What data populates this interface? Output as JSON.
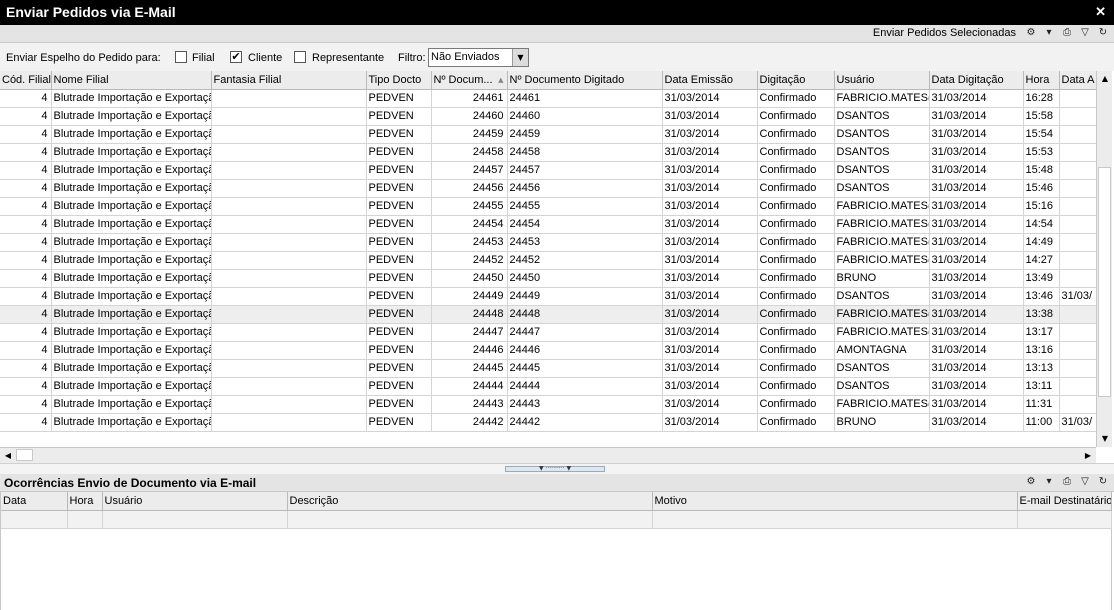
{
  "window": {
    "title": "Enviar Pedidos via E-Mail",
    "close": "✕"
  },
  "toolbar": {
    "send_selected_label": "Enviar Pedidos Selecionadas"
  },
  "filters": {
    "send_to_label": "Enviar Espelho do Pedido para:",
    "filial_label": "Filial",
    "filial_checked": false,
    "cliente_label": "Cliente",
    "cliente_checked": true,
    "representante_label": "Representante",
    "representante_checked": false,
    "filtro_label": "Filtro:",
    "filtro_value": "Não Enviados"
  },
  "orders_grid": {
    "columns": [
      "Cód. Filial",
      "Nome Filial",
      "Fantasia Filial",
      "Tipo Docto",
      "Nº Docum...",
      "Nº Documento Digitado",
      "Data Emissão",
      "Digitação",
      "Usuário",
      "Data Digitação",
      "Hora",
      "Data A"
    ],
    "sort_indicator": "▲",
    "selected_row": 12,
    "rows": [
      [
        "4",
        "Blutrade Importação e Exportação",
        "",
        "PEDVEN",
        "24461",
        "24461",
        "31/03/2014",
        "Confirmado",
        "FABRICIO.MATES(",
        "31/03/2014",
        "16:28",
        ""
      ],
      [
        "4",
        "Blutrade Importação e Exportação",
        "",
        "PEDVEN",
        "24460",
        "24460",
        "31/03/2014",
        "Confirmado",
        "DSANTOS",
        "31/03/2014",
        "15:58",
        ""
      ],
      [
        "4",
        "Blutrade Importação e Exportação",
        "",
        "PEDVEN",
        "24459",
        "24459",
        "31/03/2014",
        "Confirmado",
        "DSANTOS",
        "31/03/2014",
        "15:54",
        ""
      ],
      [
        "4",
        "Blutrade Importação e Exportação",
        "",
        "PEDVEN",
        "24458",
        "24458",
        "31/03/2014",
        "Confirmado",
        "DSANTOS",
        "31/03/2014",
        "15:53",
        ""
      ],
      [
        "4",
        "Blutrade Importação e Exportação",
        "",
        "PEDVEN",
        "24457",
        "24457",
        "31/03/2014",
        "Confirmado",
        "DSANTOS",
        "31/03/2014",
        "15:48",
        ""
      ],
      [
        "4",
        "Blutrade Importação e Exportação",
        "",
        "PEDVEN",
        "24456",
        "24456",
        "31/03/2014",
        "Confirmado",
        "DSANTOS",
        "31/03/2014",
        "15:46",
        ""
      ],
      [
        "4",
        "Blutrade Importação e Exportação",
        "",
        "PEDVEN",
        "24455",
        "24455",
        "31/03/2014",
        "Confirmado",
        "FABRICIO.MATES(",
        "31/03/2014",
        "15:16",
        ""
      ],
      [
        "4",
        "Blutrade Importação e Exportação",
        "",
        "PEDVEN",
        "24454",
        "24454",
        "31/03/2014",
        "Confirmado",
        "FABRICIO.MATES(",
        "31/03/2014",
        "14:54",
        ""
      ],
      [
        "4",
        "Blutrade Importação e Exportação",
        "",
        "PEDVEN",
        "24453",
        "24453",
        "31/03/2014",
        "Confirmado",
        "FABRICIO.MATES(",
        "31/03/2014",
        "14:49",
        ""
      ],
      [
        "4",
        "Blutrade Importação e Exportação",
        "",
        "PEDVEN",
        "24452",
        "24452",
        "31/03/2014",
        "Confirmado",
        "FABRICIO.MATES(",
        "31/03/2014",
        "14:27",
        ""
      ],
      [
        "4",
        "Blutrade Importação e Exportação",
        "",
        "PEDVEN",
        "24450",
        "24450",
        "31/03/2014",
        "Confirmado",
        "BRUNO",
        "31/03/2014",
        "13:49",
        ""
      ],
      [
        "4",
        "Blutrade Importação e Exportação",
        "",
        "PEDVEN",
        "24449",
        "24449",
        "31/03/2014",
        "Confirmado",
        "DSANTOS",
        "31/03/2014",
        "13:46",
        "31/03/"
      ],
      [
        "4",
        "Blutrade Importação e Exportação",
        "",
        "PEDVEN",
        "24448",
        "24448",
        "31/03/2014",
        "Confirmado",
        "FABRICIO.MATES(",
        "31/03/2014",
        "13:38",
        ""
      ],
      [
        "4",
        "Blutrade Importação e Exportação",
        "",
        "PEDVEN",
        "24447",
        "24447",
        "31/03/2014",
        "Confirmado",
        "FABRICIO.MATES(",
        "31/03/2014",
        "13:17",
        ""
      ],
      [
        "4",
        "Blutrade Importação e Exportação",
        "",
        "PEDVEN",
        "24446",
        "24446",
        "31/03/2014",
        "Confirmado",
        "AMONTAGNA",
        "31/03/2014",
        "13:16",
        ""
      ],
      [
        "4",
        "Blutrade Importação e Exportação",
        "",
        "PEDVEN",
        "24445",
        "24445",
        "31/03/2014",
        "Confirmado",
        "DSANTOS",
        "31/03/2014",
        "13:13",
        ""
      ],
      [
        "4",
        "Blutrade Importação e Exportação",
        "",
        "PEDVEN",
        "24444",
        "24444",
        "31/03/2014",
        "Confirmado",
        "DSANTOS",
        "31/03/2014",
        "13:11",
        ""
      ],
      [
        "4",
        "Blutrade Importação e Exportação",
        "",
        "PEDVEN",
        "24443",
        "24443",
        "31/03/2014",
        "Confirmado",
        "FABRICIO.MATES(",
        "31/03/2014",
        "11:31",
        ""
      ],
      [
        "4",
        "Blutrade Importação e Exportação",
        "",
        "PEDVEN",
        "24442",
        "24442",
        "31/03/2014",
        "Confirmado",
        "BRUNO",
        "31/03/2014",
        "11:00",
        "31/03/"
      ]
    ]
  },
  "occurrences_panel": {
    "title": "Ocorrências Envio de Documento via E-mail",
    "columns": [
      "Data",
      "Hora",
      "Usuário",
      "Descrição",
      "Motivo",
      "E-mail Destinatário"
    ]
  },
  "icons": {
    "settings": "⚙",
    "dropdown": "▾",
    "export": "⎙",
    "filter": "▽",
    "refresh": "↻",
    "scroll_up": "▲",
    "scroll_down": "▼",
    "scroll_left": "◀",
    "scroll_right": "▶",
    "check": "✔"
  },
  "colors": {
    "titlebar_bg": "#000000",
    "toolbar_bg": "#e4e4e4",
    "header_bg": "#ececec",
    "selected_row_bg": "#eeeeee"
  }
}
